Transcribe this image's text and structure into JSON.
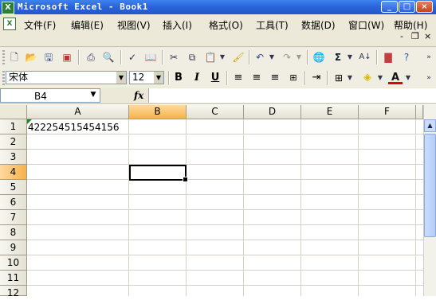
{
  "window": {
    "title": "Microsoft Excel - Book1",
    "app_icon": "excel-icon",
    "buttons": [
      "_",
      "□",
      "×"
    ]
  },
  "menu": {
    "items": [
      "文件(F)",
      "编辑(E)",
      "视图(V)",
      "插入(I)",
      "格式(O)",
      "工具(T)",
      "数据(D)",
      "窗口(W)",
      "帮助(H)"
    ],
    "doc_controls": [
      "-",
      "❐",
      "×"
    ]
  },
  "format_toolbar": {
    "font_name": "宋体",
    "font_size": "12",
    "bold": "B",
    "italic": "I",
    "underline": "U"
  },
  "formula_bar": {
    "name_box": "B4",
    "fx_label": "fx",
    "formula": ""
  },
  "grid": {
    "columns": [
      "A",
      "B",
      "C",
      "D",
      "E",
      "F"
    ],
    "rows": [
      "1",
      "2",
      "3",
      "4",
      "5",
      "6",
      "7",
      "8",
      "9",
      "10",
      "11",
      "12"
    ],
    "active_column": "B",
    "active_row": "4",
    "cells": {
      "A1": "422254515454156"
    }
  },
  "colors": {
    "title_bar": "#2a63d8",
    "chrome": "#ece9d8",
    "active_header": "#f5b34a",
    "gridline": "#d4d0c8"
  }
}
